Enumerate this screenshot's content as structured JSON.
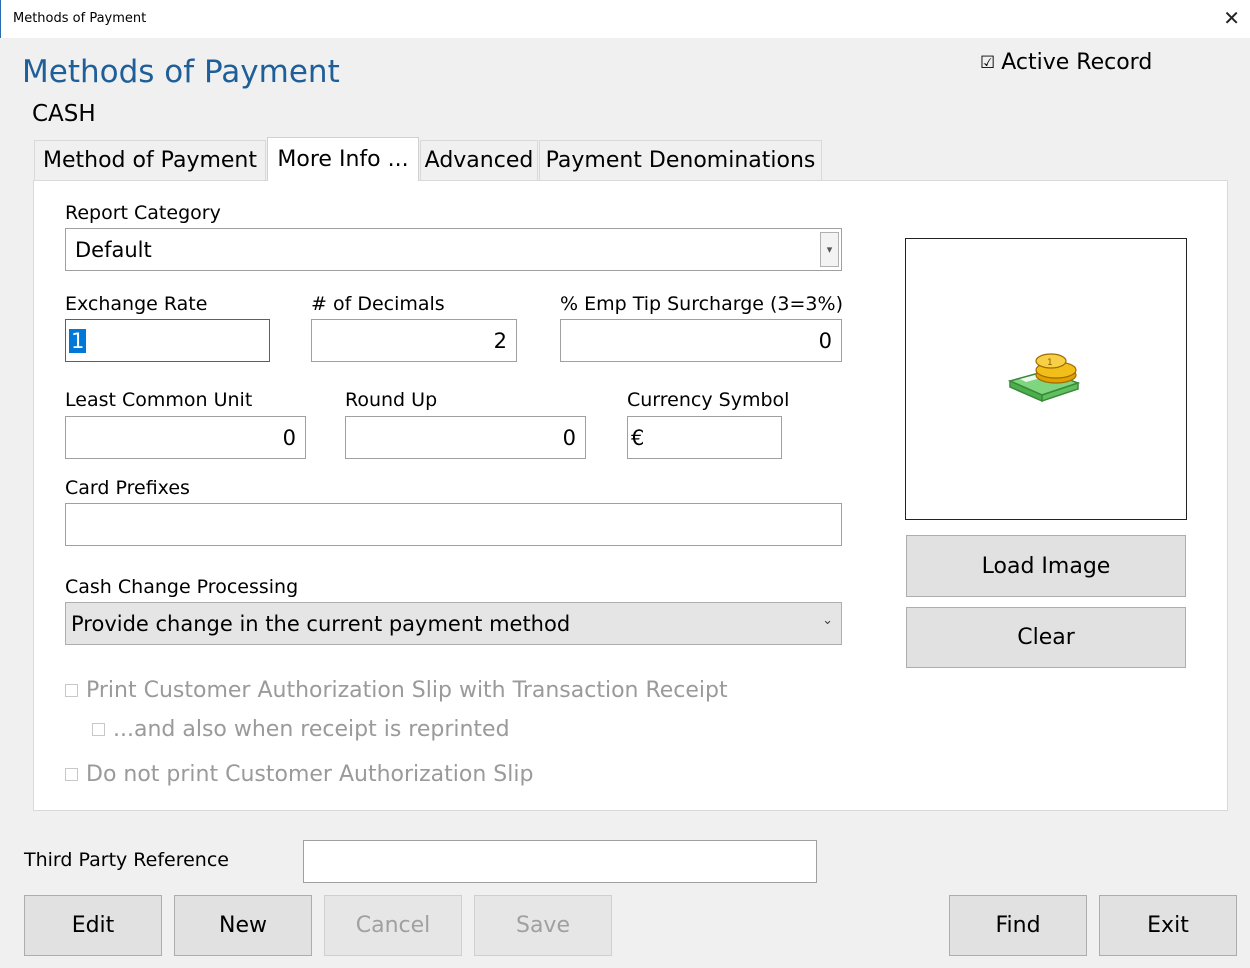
{
  "window": {
    "title": "Methods of Payment",
    "close_glyph": "✕"
  },
  "header": {
    "title": "Methods of Payment",
    "subtitle": "CASH",
    "active_record_label": "Active Record",
    "active_record_checked": true
  },
  "tabs": [
    {
      "label": "Method of Payment"
    },
    {
      "label": "More Info ..."
    },
    {
      "label": "Advanced"
    },
    {
      "label": "Payment Denominations"
    }
  ],
  "form": {
    "report_category": {
      "label": "Report Category",
      "value": "Default"
    },
    "exchange_rate": {
      "label": "Exchange Rate",
      "value": "1"
    },
    "decimals": {
      "label": "# of Decimals",
      "value": "2"
    },
    "tip_surcharge": {
      "label": "% Emp Tip Surcharge (3=3%)",
      "value": "0"
    },
    "least_common_unit": {
      "label": "Least Common Unit",
      "value": "0"
    },
    "round_up": {
      "label": "Round Up",
      "value": "0"
    },
    "currency_symbol": {
      "label": "Currency Symbol",
      "value": "€"
    },
    "card_prefixes": {
      "label": "Card Prefixes",
      "value": ""
    },
    "cash_change": {
      "label": "Cash Change Processing",
      "value": "Provide change in the current payment method"
    },
    "checkboxes": {
      "print_auth_slip": "Print Customer Authorization Slip with Transaction Receipt",
      "also_reprinted": "...and also when receipt is reprinted",
      "do_not_print": "Do not print Customer Authorization Slip"
    }
  },
  "image_panel": {
    "icon": "cash-coins-icon",
    "load_label": "Load Image",
    "clear_label": "Clear"
  },
  "third_party": {
    "label": "Third Party Reference",
    "value": ""
  },
  "footer": {
    "edit": "Edit",
    "new": "New",
    "cancel": "Cancel",
    "save": "Save",
    "find": "Find",
    "exit": "Exit"
  },
  "colors": {
    "title_blue": "#1f5f99",
    "accent_border": "#0078d7"
  }
}
